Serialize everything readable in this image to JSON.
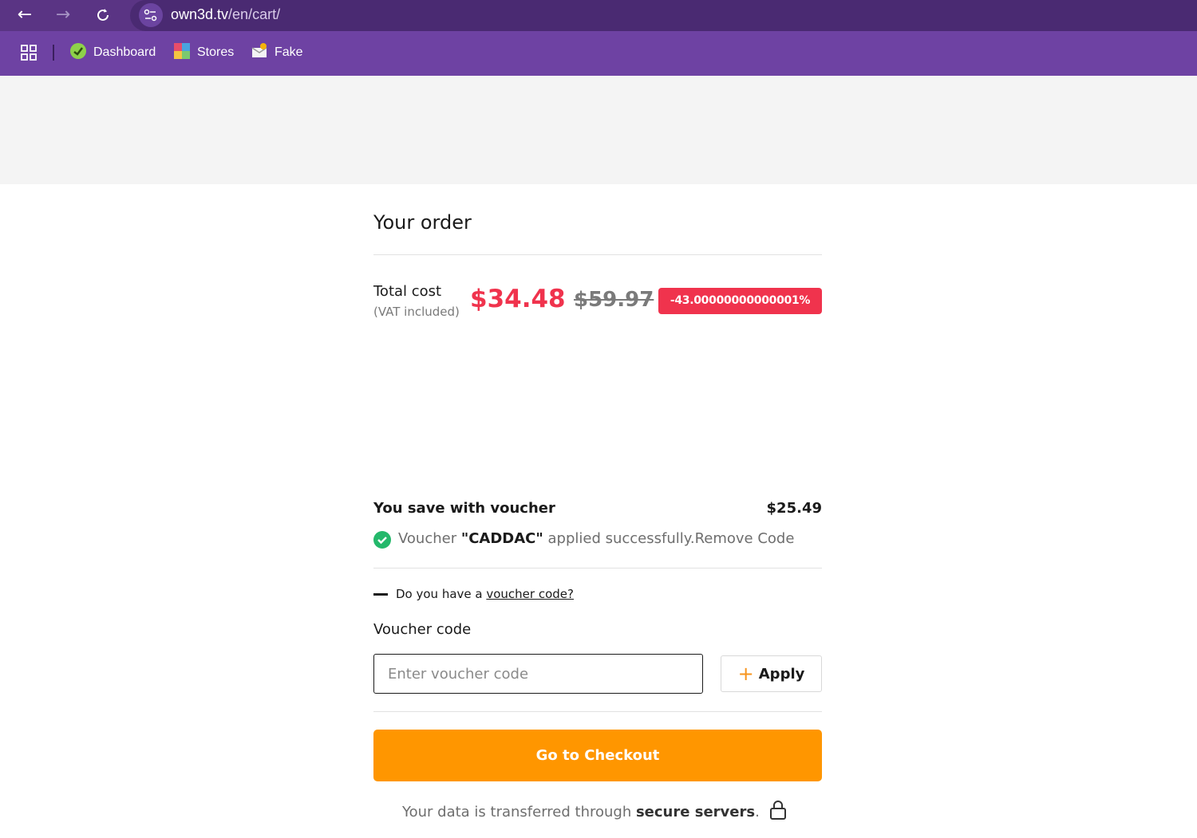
{
  "browser": {
    "url_host": "own3d.tv",
    "url_path": "/en/cart/",
    "bookmarks": [
      {
        "label": "Dashboard",
        "icon": "dashboard-favicon-icon"
      },
      {
        "label": "Stores",
        "icon": "stores-favicon-icon"
      },
      {
        "label": "Fake",
        "icon": "fake-favicon-icon"
      }
    ]
  },
  "order": {
    "title": "Your order",
    "total_label": "Total cost",
    "vat_note": "(VAT included)",
    "price_now": "$34.48",
    "price_old": "$59.97",
    "discount_badge": "-43.00000000000001%",
    "save_label": "You save with voucher",
    "save_amount": "$25.49",
    "voucher_prefix": "Voucher ",
    "voucher_code_applied": "\"CADDAC\"",
    "voucher_suffix": " applied successfully.",
    "remove_code": "Remove Code",
    "toggle_prefix": "Do you have a ",
    "toggle_link": "voucher code?",
    "voucher_label": "Voucher code",
    "voucher_placeholder": "Enter voucher code",
    "apply_label": "Apply",
    "checkout_label": "Go to Checkout",
    "secure_prefix": "Your data is transferred through ",
    "secure_bold": "secure servers",
    "secure_suffix": "."
  },
  "colors": {
    "sale_red": "#f0334d",
    "checkout_orange": "#ff9600",
    "success_green": "#24b86b",
    "chrome_purple": "#6e42a3"
  }
}
